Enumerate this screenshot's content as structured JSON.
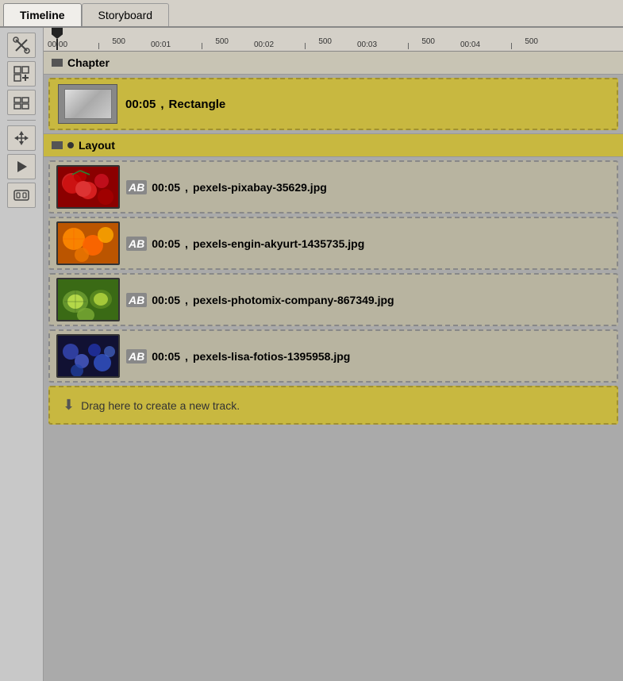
{
  "tabs": [
    {
      "id": "timeline",
      "label": "Timeline",
      "active": false
    },
    {
      "id": "storyboard",
      "label": "Storyboard",
      "active": true
    }
  ],
  "toolbar": {
    "buttons": [
      {
        "id": "cut",
        "icon": "✂",
        "label": "cut-tool"
      },
      {
        "id": "add-group",
        "icon": "⊞",
        "label": "add-group"
      },
      {
        "id": "split",
        "icon": "⧉",
        "label": "split"
      },
      {
        "id": "move",
        "icon": "⟰",
        "label": "move"
      },
      {
        "id": "play",
        "icon": "▶",
        "label": "play"
      },
      {
        "id": "fx",
        "icon": "⬡",
        "label": "fx"
      }
    ]
  },
  "ruler": {
    "marks": [
      "00:00",
      "00:01",
      "00:02",
      "00:03",
      "00:04"
    ],
    "minor_marks": [
      "500",
      "500",
      "500",
      "500",
      "500"
    ]
  },
  "chapter": {
    "label": "Chapter",
    "item": {
      "time": "00:05",
      "name": "Rectangle"
    }
  },
  "layout": {
    "label": "Layout",
    "items": [
      {
        "time": "00:05",
        "name": "pexels-pixabay-35629.jpg",
        "thumb_type": "cherry"
      },
      {
        "time": "00:05",
        "name": "pexels-engin-akyurt-1435735.jpg",
        "thumb_type": "orange"
      },
      {
        "time": "00:05",
        "name": "pexels-photomix-company-867349.jpg",
        "thumb_type": "kiwi"
      },
      {
        "time": "00:05",
        "name": "pexels-lisa-fotios-1395958.jpg",
        "thumb_type": "berry"
      }
    ]
  },
  "drag_zone": {
    "label": "Drag here to create a new track."
  }
}
